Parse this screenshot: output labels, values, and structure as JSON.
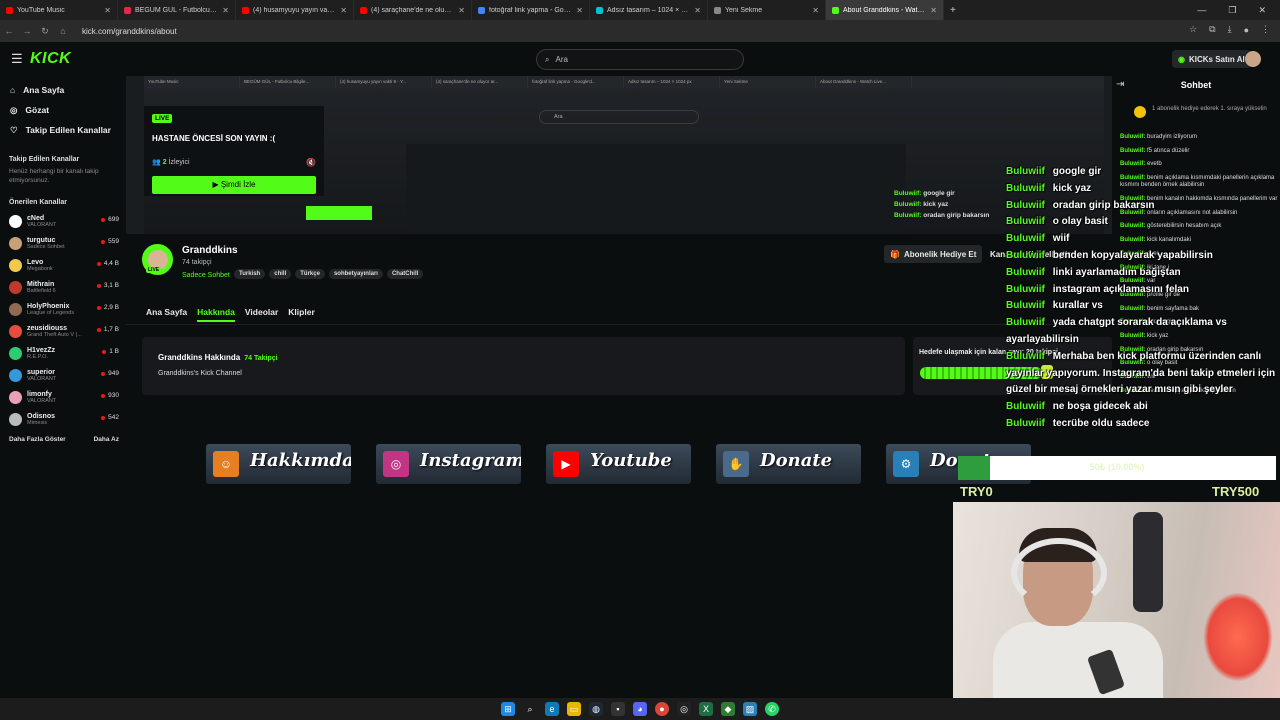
{
  "browser": {
    "tabs": [
      {
        "title": "YouTube Music",
        "color": "#ff0000"
      },
      {
        "title": "BEGÜM GÜL - Futbolcu Bilgile...",
        "color": "#e0284a"
      },
      {
        "title": "(4) husamyuyu yayın vakti 9 - Y...",
        "color": "#ff0000"
      },
      {
        "title": "(4) saraçhane'de ne oluyor ar...",
        "color": "#ff0000"
      },
      {
        "title": "fotoğraf link yapma - Google'd...",
        "color": "#4285f4"
      },
      {
        "title": "Adsız tasarım – 1024 × 1024 px",
        "color": "#00c4cc"
      },
      {
        "title": "Yeni Sekme",
        "color": "#888888"
      },
      {
        "title": "About Granddkins - Watch Live...",
        "color": "#53fc18",
        "active": true
      }
    ],
    "url": "kick.com/granddkins/about",
    "window_controls": [
      "—",
      "❐",
      "✕"
    ]
  },
  "kick": {
    "logo": "KICK",
    "search_placeholder": "Ara",
    "buy_kicks": "KICKs Satın Al"
  },
  "sidebar": {
    "nav": [
      {
        "label": "Ana Sayfa",
        "icon": "home-icon"
      },
      {
        "label": "Gözat",
        "icon": "compass-icon"
      },
      {
        "label": "Takip Edilen Kanallar",
        "icon": "heart-icon"
      }
    ],
    "followed_title": "Takip Edilen Kanallar",
    "followed_empty": "Henüz herhangi bir kanalı takip etmiyorsunuz.",
    "recommended_title": "Önerilen Kanallar",
    "channels": [
      {
        "name": "cNed",
        "category": "VALORANT",
        "viewers": "699",
        "color": "#ffffff"
      },
      {
        "name": "turgutuc",
        "category": "Sadece Sohbet",
        "viewers": "559",
        "color": "#c9a07a"
      },
      {
        "name": "Levo",
        "category": "Megabonk",
        "viewers": "4,4 B",
        "color": "#f2c94c"
      },
      {
        "name": "Mithrain",
        "category": "Battlefield 6",
        "viewers": "3,1 B",
        "color": "#c0392b"
      },
      {
        "name": "HolyPhoenix",
        "category": "League of Legends",
        "viewers": "2,9 B",
        "color": "#8e6b52"
      },
      {
        "name": "zeusidiouss",
        "category": "Grand Theft Auto V (...",
        "viewers": "1,7 B",
        "color": "#e74c3c"
      },
      {
        "name": "H1vezZz",
        "category": "R.E.P.O.",
        "viewers": "1 B",
        "color": "#2ecc71"
      },
      {
        "name": "superior",
        "category": "VALORANT",
        "viewers": "949",
        "color": "#3498db"
      },
      {
        "name": "limonfy",
        "category": "VALORANT",
        "viewers": "930",
        "color": "#e8a0b4"
      },
      {
        "name": "Odisnos",
        "category": "Mimesis",
        "viewers": "542",
        "color": "#bbbbbb"
      }
    ],
    "show_more": "Daha Fazla Göster",
    "show_less": "Daha Az"
  },
  "banner": {
    "live_badge": "LIVE",
    "title": "HASTANE ÖNCESİ SON YAYIN :(",
    "viewers_count": "2",
    "viewers_label": "İzleyici",
    "watch_button": "Şimdi İzle",
    "inner_search": "Ara",
    "inner_chat": [
      {
        "user": "Buluwiif:",
        "text": "google gir"
      },
      {
        "user": "Buluwiif:",
        "text": "kick yaz"
      },
      {
        "user": "Buluwiif:",
        "text": "oradan girip bakarsın"
      }
    ]
  },
  "channel": {
    "name": "Granddkins",
    "followers": "74 takipçi",
    "category": "Sadece Sohbet",
    "tags": [
      "Turkish",
      "chill",
      "Türkçe",
      "sohbetyayınları",
      "ChatChill"
    ],
    "sub_gift": "Abonelik Hediye Et",
    "follow": "Kanalımı Kişiselleştir",
    "tabs": [
      "Ana Sayfa",
      "Hakkında",
      "Videolar",
      "Klipler"
    ],
    "active_tab": "Hakkında",
    "about_title": "Granddkins Hakkında",
    "about_followers": "74 Takipçi",
    "about_desc": "Granddkins's Kick Channel",
    "goal_text": "Hedefe ulaşmak için kalan sayı: 20 takipçi",
    "goal_progress": 0.9,
    "panels": [
      {
        "label": "Hakkımda",
        "icon": "user-icon",
        "color": "#e67e22"
      },
      {
        "label": "Instagram",
        "icon": "instagram-icon",
        "color": "#c13584"
      },
      {
        "label": "Youtube",
        "icon": "youtube-icon",
        "color": "#ff0000"
      },
      {
        "label": "Donate",
        "icon": "donate-icon",
        "color": "#4a6a8a"
      },
      {
        "label": "Donate",
        "icon": "gear-icon",
        "color": "#2980b9"
      }
    ]
  },
  "chat": {
    "title": "Sohbet",
    "pinned": "1 abonelik hediye ederek 1. sıraya yükselin",
    "messages": [
      {
        "user": "Buluwiif:",
        "text": "buradyim izliyorum"
      },
      {
        "user": "Buluwiif:",
        "text": "f5 atınca düzelir"
      },
      {
        "user": "Buluwiif:",
        "text": "evetb"
      },
      {
        "user": "Buluwiif:",
        "text": "benim açıklama kısmımdaki panellerin açıklama kısmını benden örnek alabilirsin"
      },
      {
        "user": "Buluwiif:",
        "text": "benim kanalın hakkımda kısmında panellerim var"
      },
      {
        "user": "Buluwiif:",
        "text": "onların açıklamasını not alabilirsin"
      },
      {
        "user": "Buluwiif:",
        "text": "gösterebilirsin hesabım açık"
      },
      {
        "user": "Buluwiif:",
        "text": "kick kanalımdaki"
      },
      {
        "user": "Buluwiif:",
        "text": "evet"
      },
      {
        "user": "Buluwiif:",
        "text": "iki tane i"
      },
      {
        "user": "Buluwiif:",
        "text": "var"
      },
      {
        "user": "Buluwiif:",
        "text": "profile gir de"
      },
      {
        "user": "Buluwiif:",
        "text": "benim sayfama bak"
      },
      {
        "user": "Buluwiif:",
        "text": "google gir"
      },
      {
        "user": "Buluwiif:",
        "text": "kick yaz"
      },
      {
        "user": "Buluwiif:",
        "text": "oradan girip bakarsın"
      },
      {
        "user": "Buluwiif:",
        "text": "o olay basit"
      },
      {
        "user": "Buluwiif:",
        "text": "wiif"
      },
      {
        "user": "Buluwiif:",
        "text": "benden kopyalayarak yapabilirsin"
      }
    ]
  },
  "overlay": {
    "chat": [
      {
        "user": "Buluwiif",
        "text": "google gir"
      },
      {
        "user": "Buluwiif",
        "text": "kick yaz"
      },
      {
        "user": "Buluwiif",
        "text": "oradan girip bakarsın"
      },
      {
        "user": "Buluwiif",
        "text": "o olay basit"
      },
      {
        "user": "Buluwiif",
        "text": "wiif"
      },
      {
        "user": "Buluwiif",
        "text": "benden kopyalayarak yapabilirsin"
      },
      {
        "user": "Buluwiif",
        "text": "linki ayarlamadım bağıştan"
      },
      {
        "user": "Buluwiif",
        "text": "instagram açıklamasını felan"
      },
      {
        "user": "Buluwiif",
        "text": "kurallar vs"
      },
      {
        "user": "Buluwiif",
        "text": "yada chatgpt sorarak da açıklama vs ayarlayabilirsin"
      },
      {
        "user": "Buluwiif",
        "text": "Merhaba ben kick platformu üzerinden canlı yayınlar yapıyorum. Instagram'da beni takip etmeleri için güzel bir mesaj örnekleri yazar mısın gibi şeyler"
      },
      {
        "user": "Buluwiif",
        "text": "ne boşa gidecek abi"
      },
      {
        "user": "Buluwiif",
        "text": "tecrübe oldu sadece"
      }
    ],
    "donation_goal": "50₺ (10.00%)",
    "donation_progress": 0.1,
    "min_label": "TRY0",
    "max_label": "TRY500"
  }
}
